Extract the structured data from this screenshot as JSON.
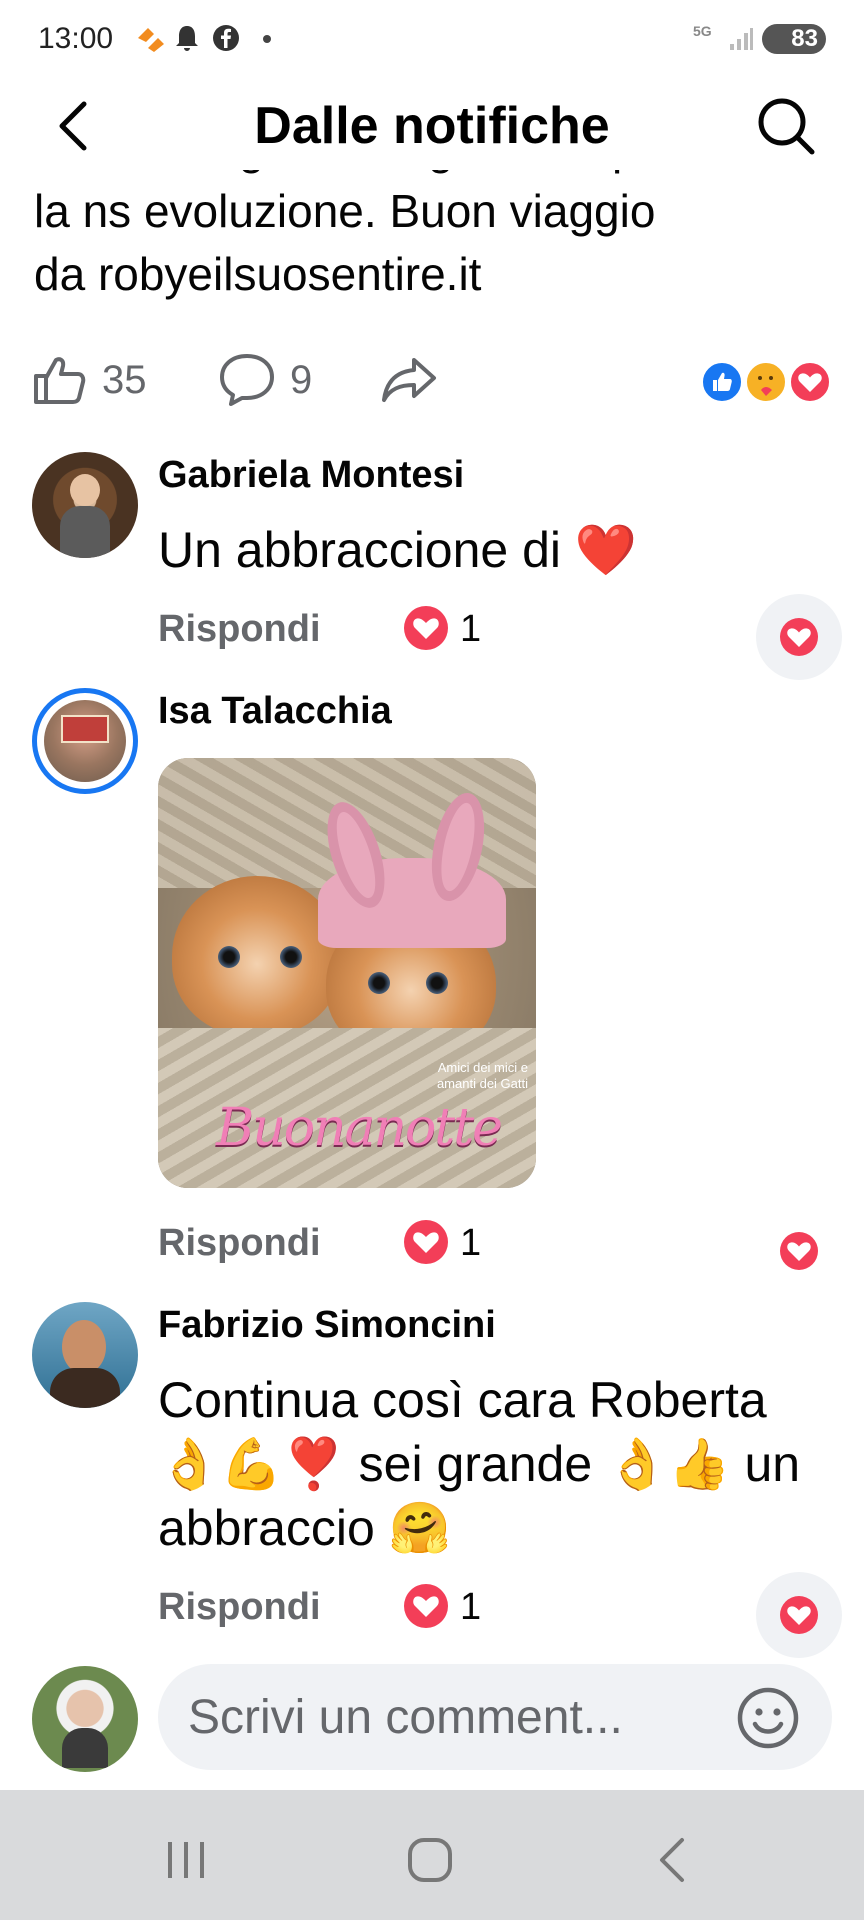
{
  "status_bar": {
    "time": "13:00",
    "icons": [
      "strava-icon",
      "bell-icon",
      "facebook-icon",
      "dot-icon"
    ],
    "network": "5G",
    "battery": "83"
  },
  "header": {
    "title": "Dalle notifiche",
    "back_icon": "chevron-left-icon",
    "search_icon": "search-icon"
  },
  "post": {
    "text_partial_line": "hanno un grande significato per",
    "text_lines": [
      "la ns evoluzione. Buon viaggio",
      "da robyeilsuosentire.it"
    ],
    "likes": "35",
    "comments": "9",
    "reactions": [
      "like",
      "care",
      "love"
    ]
  },
  "comments": [
    {
      "author": "Gabriela Montesi",
      "text": "Un abbraccione di ❤️",
      "reply_label": "Rispondi",
      "reaction_count": "1"
    },
    {
      "author": "Isa Talacchia",
      "image_caption": "Amici dei mici e amanti dei Gatti",
      "image_text": "Buonanotte",
      "reply_label": "Rispondi",
      "reaction_count": "1"
    },
    {
      "author": "Fabrizio Simoncini",
      "text_lines": [
        "Continua così cara Roberta",
        "👌💪❣️ sei grande 👌👍 un",
        "abbraccio 🤗"
      ],
      "reply_label": "Rispondi",
      "reaction_count": "1"
    }
  ],
  "composer": {
    "placeholder": "Scrivi un comment..."
  },
  "colors": {
    "love": "#f33e58",
    "like": "#1877f2",
    "secondary_text": "#65676b",
    "field_bg": "#f0f2f5"
  }
}
